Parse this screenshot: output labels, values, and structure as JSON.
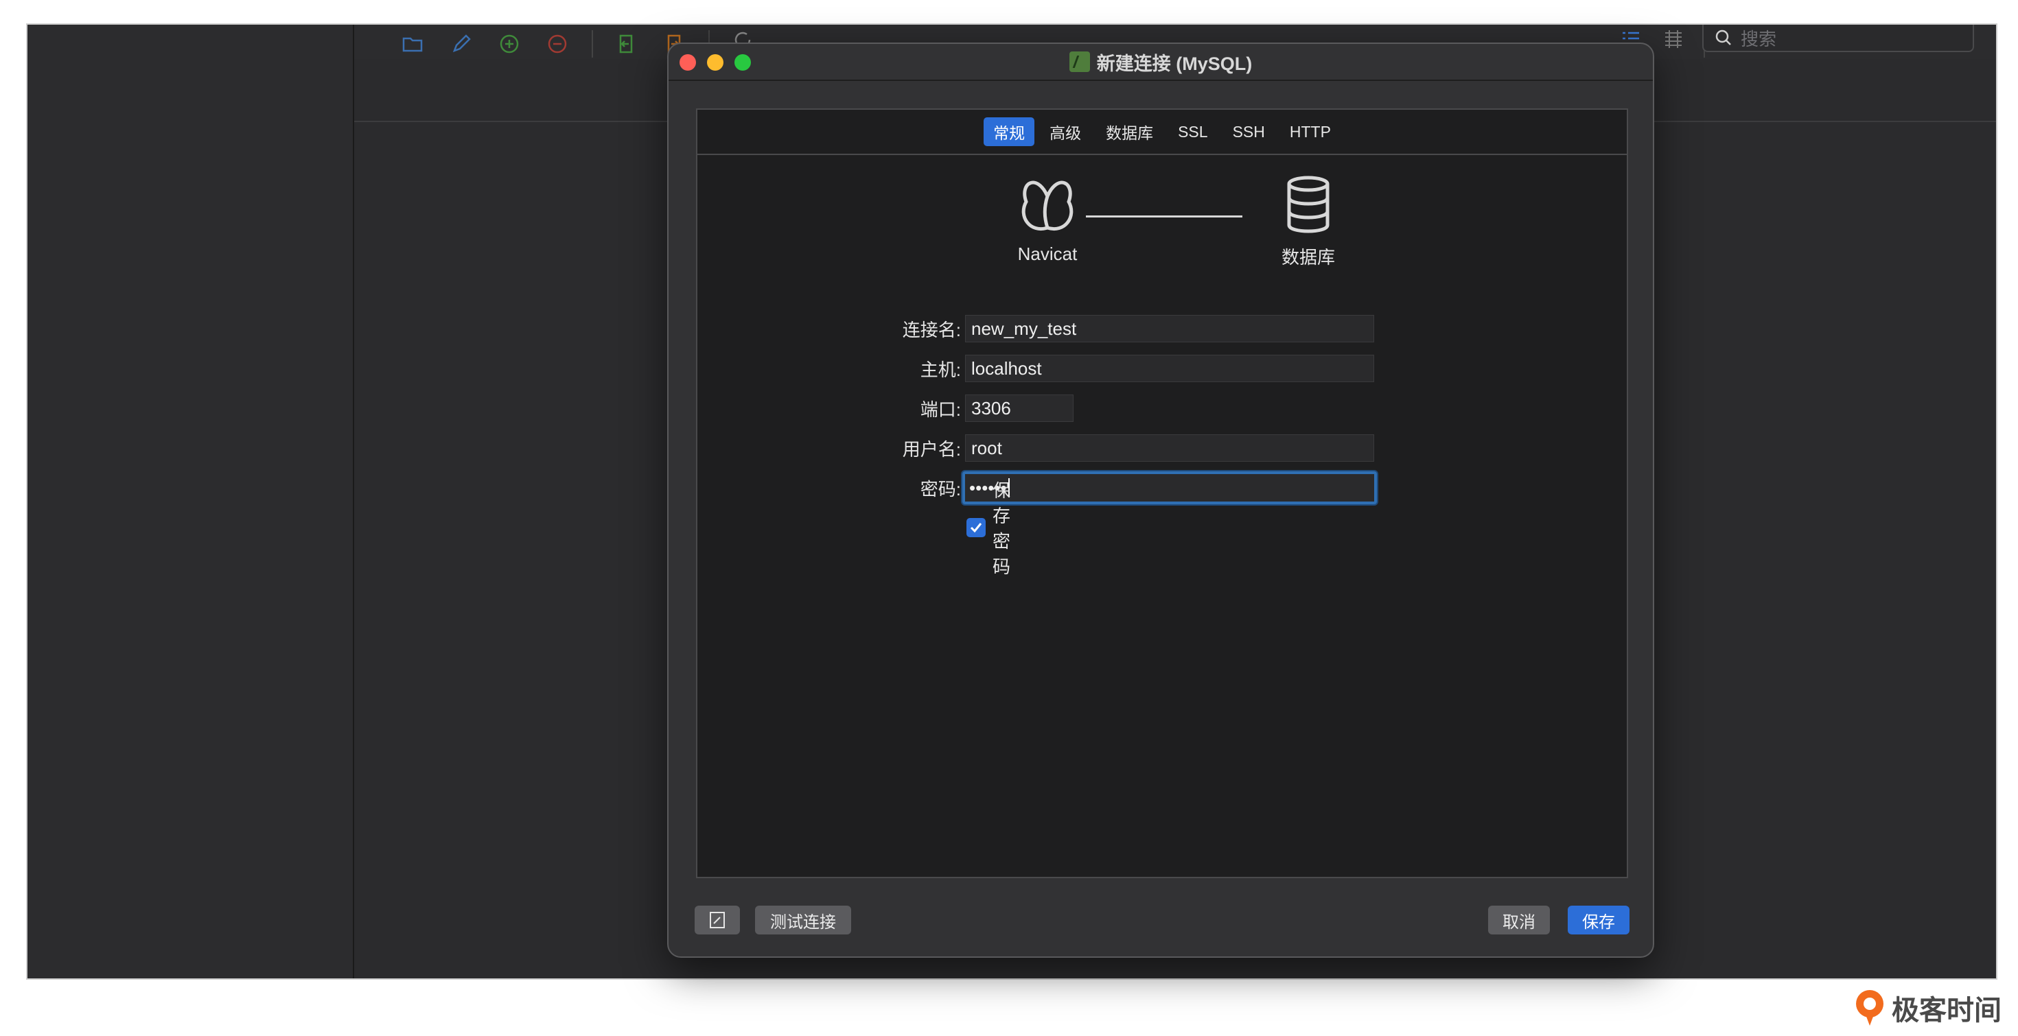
{
  "app": {
    "search": {
      "placeholder": "搜索",
      "icon": "search-icon"
    },
    "toolbar_icons": [
      "folder-open-icon",
      "pencil-icon",
      "add-circle-icon",
      "remove-circle-icon",
      "import-icon",
      "export-icon",
      "refresh-icon",
      "list-view-icon",
      "grid-view-icon"
    ]
  },
  "dialog": {
    "title": "新建连接 (MySQL)",
    "tabs": [
      {
        "label": "常规",
        "active": true
      },
      {
        "label": "高级",
        "active": false
      },
      {
        "label": "数据库",
        "active": false
      },
      {
        "label": "SSL",
        "active": false
      },
      {
        "label": "SSH",
        "active": false
      },
      {
        "label": "HTTP",
        "active": false
      }
    ],
    "diagram": {
      "left_label": "Navicat",
      "right_label": "数据库"
    },
    "form": {
      "connection_name_label": "连接名:",
      "connection_name_value": "new_my_test",
      "host_label": "主机:",
      "host_value": "localhost",
      "port_label": "端口:",
      "port_value": "3306",
      "user_label": "用户名:",
      "user_value": "root",
      "password_label": "密码:",
      "password_value": "••••••",
      "save_password_label": "保存密码",
      "save_password_checked": true
    },
    "footer": {
      "test_connection_label": "测试连接",
      "cancel_label": "取消",
      "save_label": "保存"
    }
  },
  "brand": {
    "text": "极客时间"
  },
  "colors": {
    "accent": "#2c6ed8",
    "close": "#ff5f57",
    "minimize": "#febc2e",
    "maximize": "#28c840",
    "brand_orange": "#f26b1d"
  }
}
